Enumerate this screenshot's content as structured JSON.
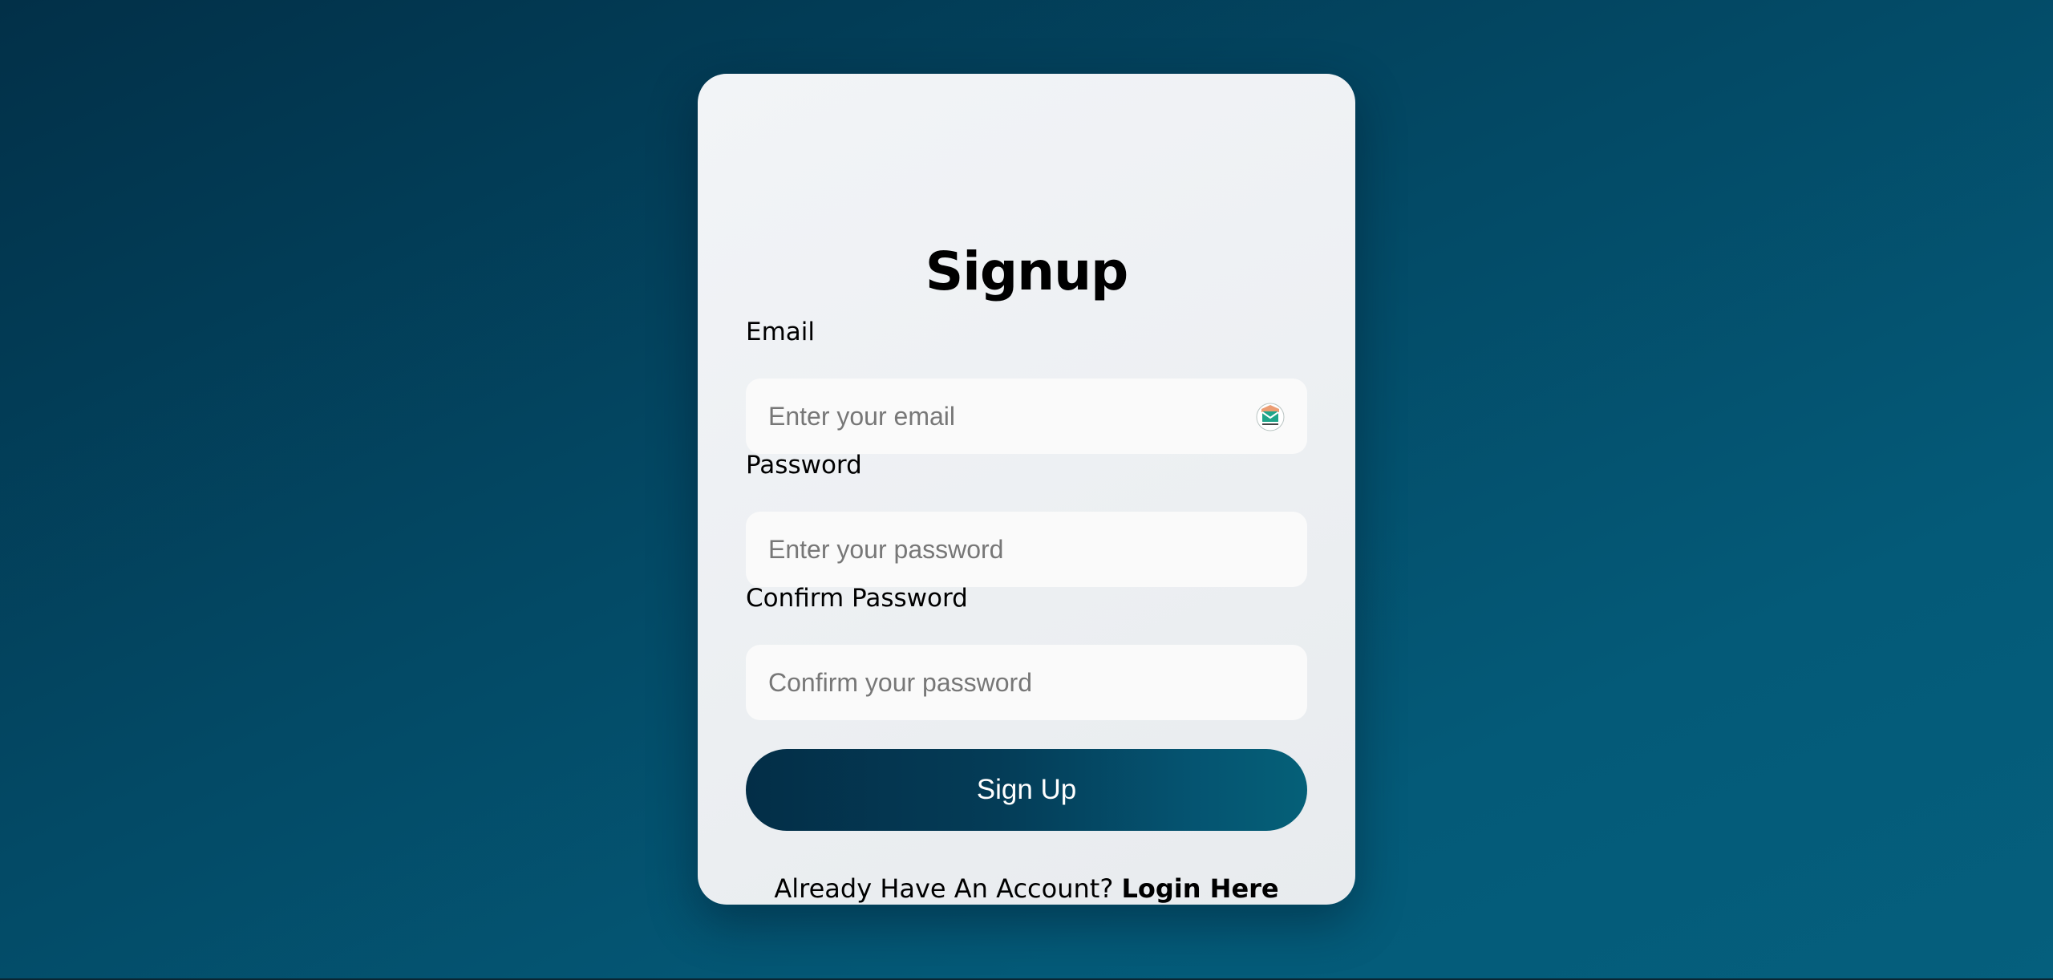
{
  "signup": {
    "title": "Signup",
    "fields": {
      "email": {
        "label": "Email",
        "placeholder": "Enter your email",
        "value": ""
      },
      "password": {
        "label": "Password",
        "placeholder": "Enter your password",
        "value": ""
      },
      "confirm_password": {
        "label": "Confirm Password",
        "placeholder": "Confirm your password",
        "value": ""
      }
    },
    "submit_label": "Sign Up",
    "footer": {
      "prompt": "Already Have An Account?",
      "link_label": "Login Here"
    }
  },
  "icons": {
    "email_field_icon": "email-extension-icon"
  },
  "colors": {
    "background_start": "#023048",
    "background_end": "#055f7d",
    "card": "#eef1f4",
    "input": "#fafafa",
    "button_start": "#032e47",
    "button_end": "#056078",
    "button_text": "#ffffff",
    "text": "#000000",
    "placeholder": "#777777"
  }
}
